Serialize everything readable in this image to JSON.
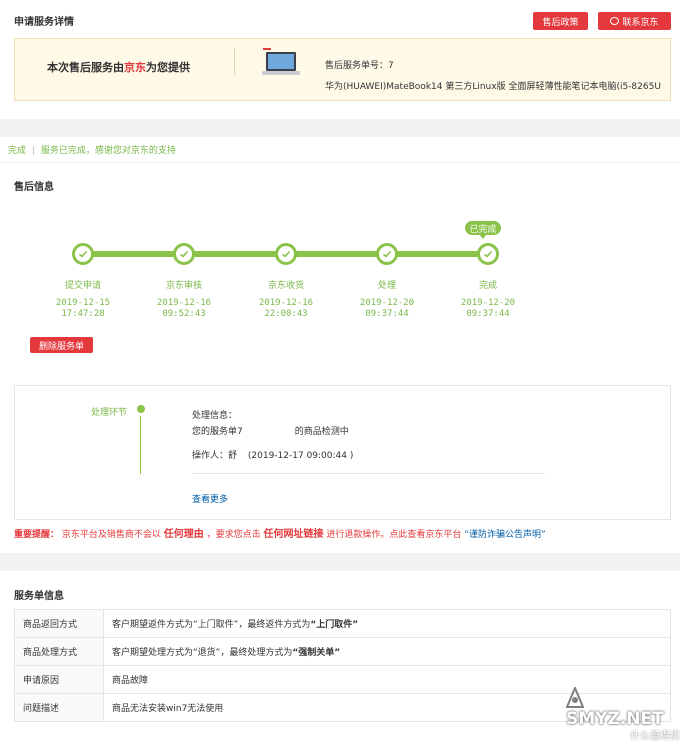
{
  "header": {
    "title": "申请服务详情",
    "policy_button": "售后政策",
    "contact_button": "联系京东"
  },
  "provider": {
    "prefix": "本次售后服务由",
    "brand": "京东",
    "suffix": "为您提供",
    "service_no_label": "售后服务单号：",
    "service_no_value": "7",
    "product_name": "华为(HUAWEI)MateBook14 第三方Linux版 全面屏轻薄性能笔记本电脑(i5-8265U"
  },
  "status": {
    "state": "完成",
    "separator": "|",
    "message": "服务已完成，感谢您对京东的支持"
  },
  "aftersale": {
    "title": "售后信息",
    "done_badge": "已完成",
    "steps": [
      {
        "label": "提交申请",
        "date": "2019-12-15",
        "time": "17:47:28"
      },
      {
        "label": "京东审核",
        "date": "2019-12-16",
        "time": "09:52:43"
      },
      {
        "label": "京东收货",
        "date": "2019-12-16",
        "time": "22:00:43"
      },
      {
        "label": "处理",
        "date": "2019-12-20",
        "time": "09:37:44"
      },
      {
        "label": "完成",
        "date": "2019-12-20",
        "time": "09:37:44"
      }
    ],
    "delete_button": "删除服务单"
  },
  "process": {
    "stage_label": "处理环节",
    "info_title": "处理信息：",
    "info_prefix": "您的服务单7",
    "info_suffix": "的商品检测中",
    "operator_label": "操作人：舒",
    "operator_time": "(2019-12-17 09:00:44 )",
    "more_link": "查看更多"
  },
  "notice": {
    "label": "重要提醒：",
    "part1": "京东平台及销售商不会以",
    "emph1": "任何理由",
    "part2": "，要求您点击",
    "emph2": "任何网址链接",
    "part3": "进行退款操作。点此查看京东平台",
    "link": "“谨防诈骗公告声明”"
  },
  "service_info": {
    "title": "服务单信息",
    "rows": [
      {
        "key": "商品返回方式",
        "value_pre": "客户期望返件方式为“上门取件”，最终返件方式为",
        "value_bold": "“上门取件”"
      },
      {
        "key": "商品处理方式",
        "value_pre": "客户期望处理方式为“退货”，最终处理方式为",
        "value_bold": "“强制关单”"
      },
      {
        "key": "申请原因",
        "value_pre": "商品故障",
        "value_bold": ""
      },
      {
        "key": "问题描述",
        "value_pre": "商品无法安装win7无法使用",
        "value_bold": ""
      }
    ]
  },
  "watermark": {
    "text": "SMYZ.NET",
    "sub": "什么值得买"
  },
  "colors": {
    "accent_red": "#e4393c",
    "green": "#8bc34a",
    "link_blue": "#005ea7"
  }
}
